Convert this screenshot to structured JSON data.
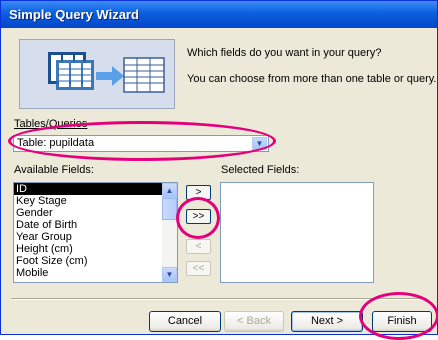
{
  "window": {
    "title": "Simple Query Wizard"
  },
  "intro": {
    "line1": "Which fields do you want in your query?",
    "line2": "You can choose from more than one table or query."
  },
  "tables_queries": {
    "label": "Tables/Queries",
    "value": "Table: pupildata"
  },
  "available": {
    "label": "Available Fields:",
    "fields": [
      "ID",
      "Key Stage",
      "Gender",
      "Date of Birth",
      "Year Group",
      "Height (cm)",
      "Foot Size (cm)",
      "Mobile"
    ],
    "selected": "ID"
  },
  "selected_fields": {
    "label": "Selected Fields:",
    "fields": []
  },
  "move_buttons": {
    "add": ">",
    "add_all": ">>",
    "remove": "<",
    "remove_all": "<<"
  },
  "buttons": {
    "cancel": "Cancel",
    "back": "< Back",
    "next": "Next >",
    "finish": "Finish"
  },
  "colors": {
    "highlight_ring": "#e4007c",
    "titlebar": "#0a5fe0"
  },
  "icons": [
    "tables-transfer-illustration",
    "dropdown-arrow-icon",
    "scroll-up-icon",
    "scroll-down-icon"
  ]
}
